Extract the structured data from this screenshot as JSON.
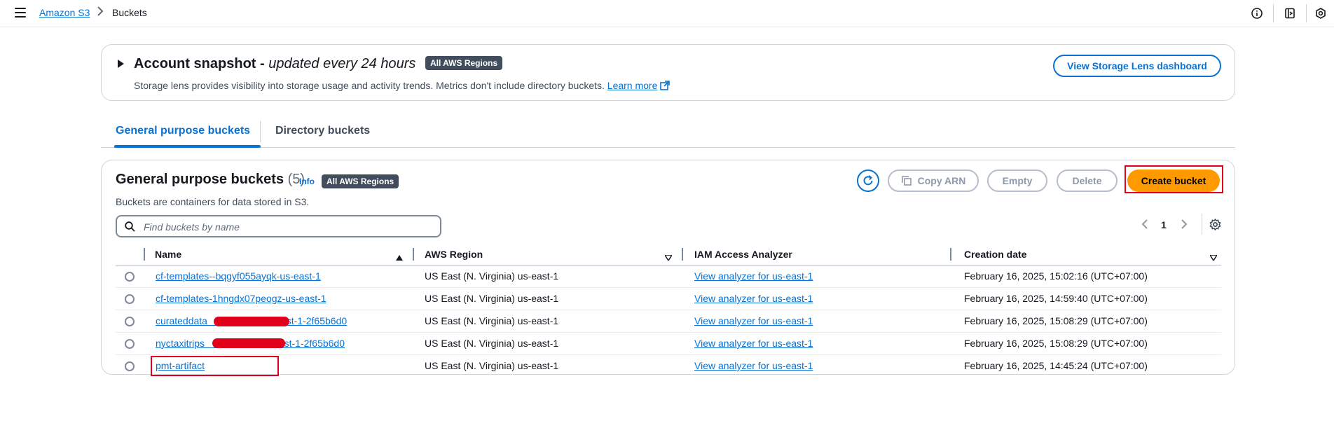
{
  "breadcrumb": {
    "root": "Amazon S3",
    "current": "Buckets"
  },
  "top_icons": [
    "info-icon",
    "notes-icon",
    "settings-gear-icon"
  ],
  "snapshot": {
    "title": "Account snapshot - ",
    "subtitle": "updated every 24 hours",
    "badge": "All AWS Regions",
    "description": "Storage lens provides visibility into storage usage and activity trends. Metrics don't include directory buckets.",
    "learn_more": "Learn more",
    "dashboard_button": "View Storage Lens dashboard"
  },
  "tabs": [
    {
      "label": "General purpose buckets",
      "active": true
    },
    {
      "label": "Directory buckets",
      "active": false
    }
  ],
  "buckets": {
    "title": "General purpose buckets",
    "count": "(5)",
    "info": "Info",
    "badge": "All AWS Regions",
    "description": "Buckets are containers for data stored in S3.",
    "actions": {
      "copy_arn": "Copy ARN",
      "empty": "Empty",
      "delete": "Delete",
      "create": "Create bucket"
    },
    "search_placeholder": "Find buckets by name",
    "page": "1",
    "columns": [
      "Name",
      "AWS Region",
      "IAM Access Analyzer",
      "Creation date"
    ],
    "rows": [
      {
        "name": "cf-templates--bqgyf055ayqk-us-east-1",
        "region": "US East (N. Virginia) us-east-1",
        "analyzer": "View analyzer for us-east-1",
        "created": "February 16, 2025, 15:02:16 (UTC+07:00)"
      },
      {
        "name": "cf-templates-1hngdx07peogz-us-east-1",
        "region": "US East (N. Virginia) us-east-1",
        "analyzer": "View analyzer for us-east-1",
        "created": "February 16, 2025, 14:59:40 (UTC+07:00)"
      },
      {
        "name": "curateddata                    us-east-1-2f65b6d0",
        "region": "US East (N. Virginia) us-east-1",
        "analyzer": "View analyzer for us-east-1",
        "created": "February 16, 2025, 15:08:29 (UTC+07:00)"
      },
      {
        "name": "nyctaxitrips                   -us-east-1-2f65b6d0",
        "region": "US East (N. Virginia) us-east-1",
        "analyzer": "View analyzer for us-east-1",
        "created": "February 16, 2025, 15:08:29 (UTC+07:00)"
      },
      {
        "name": "pmt-artifact",
        "region": "US East (N. Virginia) us-east-1",
        "analyzer": "View analyzer for us-east-1",
        "created": "February 16, 2025, 14:45:24 (UTC+07:00)"
      }
    ]
  },
  "colors": {
    "link": "#0972d3",
    "primary": "#ff9900",
    "highlight": "#e0001b",
    "badge": "#414d5c"
  }
}
